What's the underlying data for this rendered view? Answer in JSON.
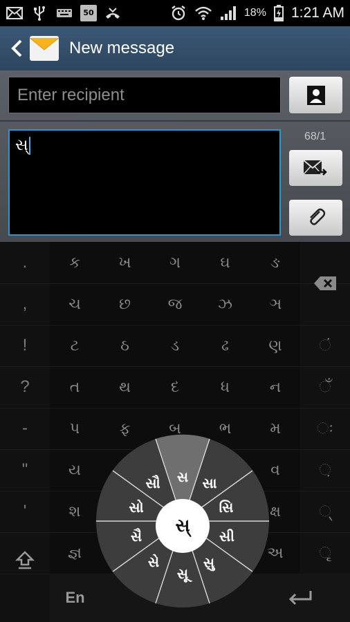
{
  "status_bar": {
    "left_icons": [
      "mail-icon",
      "usb-icon",
      "keyboard-icon",
      "weather-badge-icon",
      "missed-call-icon"
    ],
    "weather_badge": "50",
    "battery_percent": "18%",
    "time": "1:21 AM"
  },
  "action_bar": {
    "title": "New message"
  },
  "compose": {
    "recipient_placeholder": "Enter recipient",
    "message_text": "સ્",
    "char_counter": "68/1"
  },
  "keyboard": {
    "punctuation": [
      ".",
      ",",
      "!",
      "?",
      "-",
      "\"",
      "'"
    ],
    "grid_rows": [
      [
        "ક",
        "ખ",
        "ગ",
        "ઘ",
        "ઙ"
      ],
      [
        "ચ",
        "છ",
        "જ",
        "ઝ",
        "ઞ"
      ],
      [
        "ટ",
        "ઠ",
        "ડ",
        "ઢ",
        "ણ"
      ],
      [
        "ત",
        "થ",
        "દ",
        "ધ",
        "ન"
      ],
      [
        "પ",
        "ફ",
        "બ",
        "ભ",
        "મ"
      ],
      [
        "ય",
        "",
        "",
        "",
        "વ"
      ],
      [
        "શ",
        "",
        "",
        "",
        "ક્ષ"
      ],
      [
        "જ્ઞ",
        "",
        "",
        "",
        "અ"
      ]
    ],
    "signs": [
      "ં",
      "ઁ",
      "ઃ",
      "઼",
      "્",
      "ૃ"
    ],
    "lang_label": "En",
    "radial": {
      "center": "સ્",
      "items": [
        "સ",
        "સા",
        "સિ",
        "સી",
        "સુ",
        "સૂ",
        "સે",
        "સૈ",
        "સો",
        "સૌ"
      ]
    }
  }
}
